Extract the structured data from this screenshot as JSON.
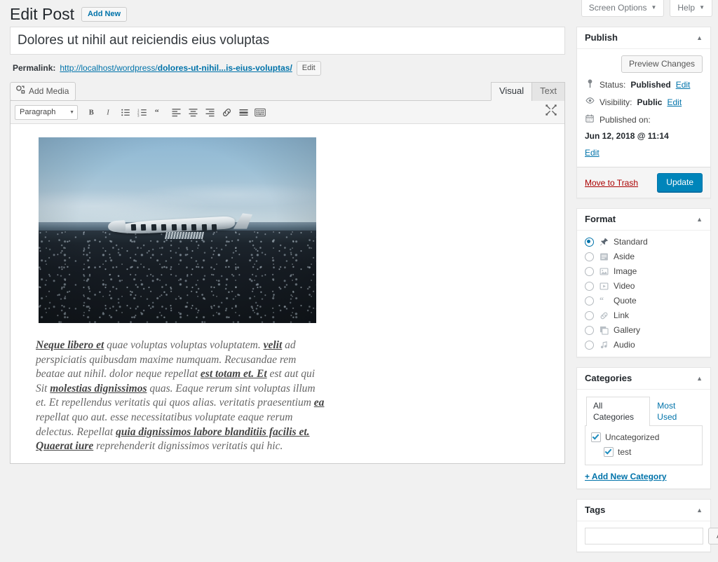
{
  "screen_meta": {
    "screen_options_label": "Screen Options",
    "help_label": "Help",
    "caret": "▼"
  },
  "header": {
    "page_title": "Edit Post",
    "add_new_label": "Add New"
  },
  "post": {
    "title_value": "Dolores ut nihil aut reiciendis eius voluptas",
    "permalink": {
      "label": "Permalink:",
      "base_url": "http://localhost/wordpress/",
      "slug": "dolores-ut-nihil...is-eius-voluptas/",
      "edit_label": "Edit"
    },
    "add_media_label": "Add Media",
    "editor_tabs": [
      {
        "label": "Visual",
        "active": true
      },
      {
        "label": "Text",
        "active": false
      }
    ],
    "toolbar": {
      "format_select_value": "Paragraph",
      "caret": "▼",
      "buttons": [
        "bold-button",
        "italic-button",
        "bulleted-list-button",
        "numbered-list-button",
        "blockquote-button",
        "align-left-button",
        "align-center-button",
        "align-right-button",
        "insert-link-button",
        "insert-read-more-button",
        "toolbar-toggle-button"
      ],
      "fullscreen_label": "Distraction-free writing mode"
    },
    "content": {
      "image_alt": "Abandoned airplane wreck on black sand beach",
      "paragraph_parts": [
        {
          "text": "Neque libero et",
          "emphasis": true
        },
        {
          "text": " quae voluptas voluptas voluptatem. ",
          "emphasis": false
        },
        {
          "text": "velit",
          "emphasis": true
        },
        {
          "text": " ad perspiciatis quibusdam maxime numquam. Recusandae rem beatae aut nihil. dolor neque repellat ",
          "emphasis": false
        },
        {
          "text": "est totam et. Et",
          "emphasis": true
        },
        {
          "text": " est aut qui Sit ",
          "emphasis": false
        },
        {
          "text": "molestias dignissimos",
          "emphasis": true
        },
        {
          "text": " quas. Eaque rerum sint voluptas illum et. Et repellendus veritatis qui quos alias. veritatis praesentium ",
          "emphasis": false
        },
        {
          "text": "ea",
          "emphasis": true
        },
        {
          "text": " repellat quo aut. esse necessitatibus voluptate eaque rerum delectus. Repellat ",
          "emphasis": false
        },
        {
          "text": "quia dignissimos labore blanditiis facilis et. Quaerat iure",
          "emphasis": true
        },
        {
          "text": " reprehenderit dignissimos veritatis qui hic.",
          "emphasis": false
        }
      ]
    }
  },
  "sidebar": {
    "publish": {
      "title": "Publish",
      "toggle": "▲",
      "preview_label": "Preview Changes",
      "status_label": "Status:",
      "status_value": "Published",
      "status_edit": "Edit",
      "visibility_label": "Visibility:",
      "visibility_value": "Public",
      "visibility_edit": "Edit",
      "published_label": "Published on:",
      "published_value": "Jun 12, 2018 @ 11:14",
      "published_edit": "Edit",
      "trash_label": "Move to Trash",
      "update_label": "Update"
    },
    "format": {
      "title": "Format",
      "toggle": "▲",
      "options": [
        {
          "label": "Standard",
          "icon": "pin-icon",
          "selected": true
        },
        {
          "label": "Aside",
          "icon": "aside-icon",
          "selected": false
        },
        {
          "label": "Image",
          "icon": "image-icon",
          "selected": false
        },
        {
          "label": "Video",
          "icon": "video-icon",
          "selected": false
        },
        {
          "label": "Quote",
          "icon": "quote-icon",
          "selected": false
        },
        {
          "label": "Link",
          "icon": "link-icon",
          "selected": false
        },
        {
          "label": "Gallery",
          "icon": "gallery-icon",
          "selected": false
        },
        {
          "label": "Audio",
          "icon": "audio-icon",
          "selected": false
        }
      ]
    },
    "categories": {
      "title": "Categories",
      "toggle": "▲",
      "tabs": [
        {
          "label": "All Categories",
          "active": true
        },
        {
          "label": "Most Used",
          "active": false
        }
      ],
      "items": [
        {
          "label": "Uncategorized",
          "checked": true,
          "child": false
        },
        {
          "label": "test",
          "checked": true,
          "child": true
        }
      ],
      "add_new_label": "+ Add New Category"
    },
    "tags": {
      "title": "Tags",
      "toggle": "▲",
      "input_value": "",
      "input_placeholder": "",
      "add_label": "Add"
    }
  },
  "colors": {
    "wp_blue": "#0085ba",
    "link_blue": "#0073aa",
    "trash_red": "#a00",
    "page_bg": "#f1f1f1"
  }
}
